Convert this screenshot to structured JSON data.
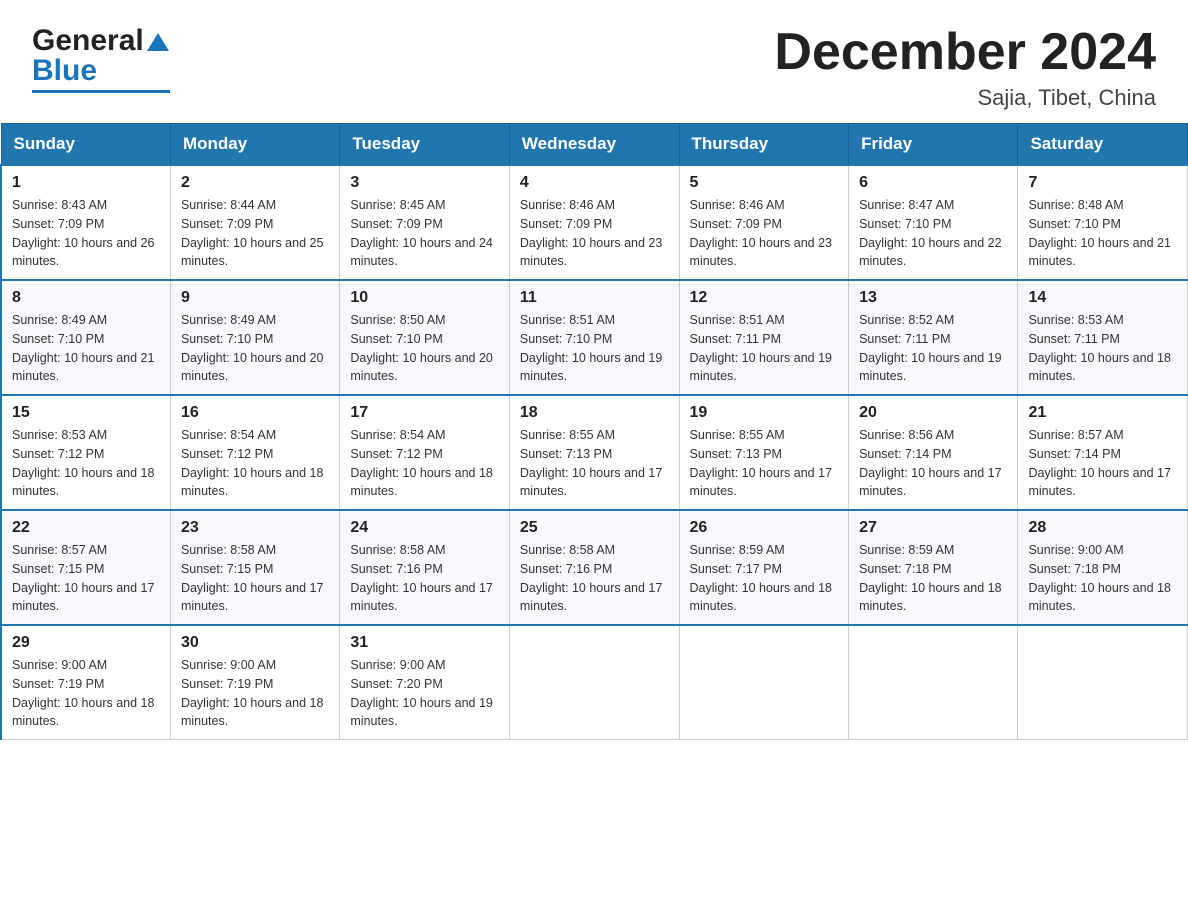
{
  "header": {
    "logo": {
      "general": "General",
      "blue": "Blue"
    },
    "title": "December 2024",
    "subtitle": "Sajia, Tibet, China"
  },
  "days_of_week": [
    "Sunday",
    "Monday",
    "Tuesday",
    "Wednesday",
    "Thursday",
    "Friday",
    "Saturday"
  ],
  "weeks": [
    [
      {
        "day": "1",
        "sunrise": "8:43 AM",
        "sunset": "7:09 PM",
        "daylight": "10 hours and 26 minutes."
      },
      {
        "day": "2",
        "sunrise": "8:44 AM",
        "sunset": "7:09 PM",
        "daylight": "10 hours and 25 minutes."
      },
      {
        "day": "3",
        "sunrise": "8:45 AM",
        "sunset": "7:09 PM",
        "daylight": "10 hours and 24 minutes."
      },
      {
        "day": "4",
        "sunrise": "8:46 AM",
        "sunset": "7:09 PM",
        "daylight": "10 hours and 23 minutes."
      },
      {
        "day": "5",
        "sunrise": "8:46 AM",
        "sunset": "7:09 PM",
        "daylight": "10 hours and 23 minutes."
      },
      {
        "day": "6",
        "sunrise": "8:47 AM",
        "sunset": "7:10 PM",
        "daylight": "10 hours and 22 minutes."
      },
      {
        "day": "7",
        "sunrise": "8:48 AM",
        "sunset": "7:10 PM",
        "daylight": "10 hours and 21 minutes."
      }
    ],
    [
      {
        "day": "8",
        "sunrise": "8:49 AM",
        "sunset": "7:10 PM",
        "daylight": "10 hours and 21 minutes."
      },
      {
        "day": "9",
        "sunrise": "8:49 AM",
        "sunset": "7:10 PM",
        "daylight": "10 hours and 20 minutes."
      },
      {
        "day": "10",
        "sunrise": "8:50 AM",
        "sunset": "7:10 PM",
        "daylight": "10 hours and 20 minutes."
      },
      {
        "day": "11",
        "sunrise": "8:51 AM",
        "sunset": "7:10 PM",
        "daylight": "10 hours and 19 minutes."
      },
      {
        "day": "12",
        "sunrise": "8:51 AM",
        "sunset": "7:11 PM",
        "daylight": "10 hours and 19 minutes."
      },
      {
        "day": "13",
        "sunrise": "8:52 AM",
        "sunset": "7:11 PM",
        "daylight": "10 hours and 19 minutes."
      },
      {
        "day": "14",
        "sunrise": "8:53 AM",
        "sunset": "7:11 PM",
        "daylight": "10 hours and 18 minutes."
      }
    ],
    [
      {
        "day": "15",
        "sunrise": "8:53 AM",
        "sunset": "7:12 PM",
        "daylight": "10 hours and 18 minutes."
      },
      {
        "day": "16",
        "sunrise": "8:54 AM",
        "sunset": "7:12 PM",
        "daylight": "10 hours and 18 minutes."
      },
      {
        "day": "17",
        "sunrise": "8:54 AM",
        "sunset": "7:12 PM",
        "daylight": "10 hours and 18 minutes."
      },
      {
        "day": "18",
        "sunrise": "8:55 AM",
        "sunset": "7:13 PM",
        "daylight": "10 hours and 17 minutes."
      },
      {
        "day": "19",
        "sunrise": "8:55 AM",
        "sunset": "7:13 PM",
        "daylight": "10 hours and 17 minutes."
      },
      {
        "day": "20",
        "sunrise": "8:56 AM",
        "sunset": "7:14 PM",
        "daylight": "10 hours and 17 minutes."
      },
      {
        "day": "21",
        "sunrise": "8:57 AM",
        "sunset": "7:14 PM",
        "daylight": "10 hours and 17 minutes."
      }
    ],
    [
      {
        "day": "22",
        "sunrise": "8:57 AM",
        "sunset": "7:15 PM",
        "daylight": "10 hours and 17 minutes."
      },
      {
        "day": "23",
        "sunrise": "8:58 AM",
        "sunset": "7:15 PM",
        "daylight": "10 hours and 17 minutes."
      },
      {
        "day": "24",
        "sunrise": "8:58 AM",
        "sunset": "7:16 PM",
        "daylight": "10 hours and 17 minutes."
      },
      {
        "day": "25",
        "sunrise": "8:58 AM",
        "sunset": "7:16 PM",
        "daylight": "10 hours and 17 minutes."
      },
      {
        "day": "26",
        "sunrise": "8:59 AM",
        "sunset": "7:17 PM",
        "daylight": "10 hours and 18 minutes."
      },
      {
        "day": "27",
        "sunrise": "8:59 AM",
        "sunset": "7:18 PM",
        "daylight": "10 hours and 18 minutes."
      },
      {
        "day": "28",
        "sunrise": "9:00 AM",
        "sunset": "7:18 PM",
        "daylight": "10 hours and 18 minutes."
      }
    ],
    [
      {
        "day": "29",
        "sunrise": "9:00 AM",
        "sunset": "7:19 PM",
        "daylight": "10 hours and 18 minutes."
      },
      {
        "day": "30",
        "sunrise": "9:00 AM",
        "sunset": "7:19 PM",
        "daylight": "10 hours and 18 minutes."
      },
      {
        "day": "31",
        "sunrise": "9:00 AM",
        "sunset": "7:20 PM",
        "daylight": "10 hours and 19 minutes."
      },
      null,
      null,
      null,
      null
    ]
  ],
  "labels": {
    "sunrise": "Sunrise:",
    "sunset": "Sunset:",
    "daylight": "Daylight:"
  }
}
